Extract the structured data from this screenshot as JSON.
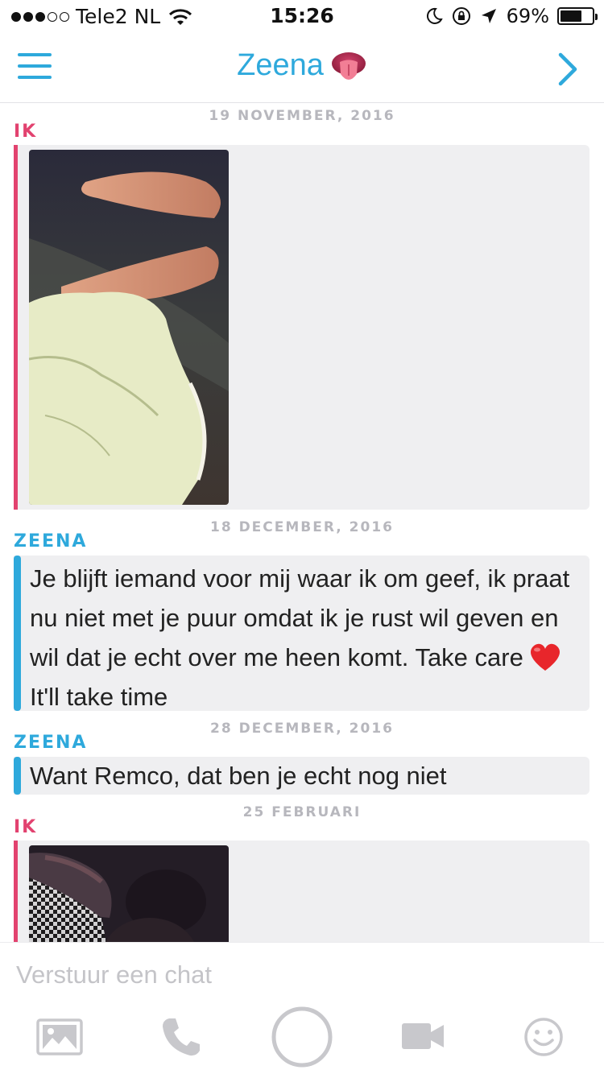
{
  "status_bar": {
    "carrier": "Tele2 NL",
    "time": "15:26",
    "battery_percent": "69%",
    "battery_level": 0.69,
    "signal_bars": 3,
    "icons": [
      "wifi-icon",
      "moon-icon",
      "rotation-lock-icon",
      "location-arrow-icon",
      "battery-icon"
    ]
  },
  "nav": {
    "title": "Zeena",
    "title_emoji": "tongue-emoji",
    "left_icon": "menu-icon",
    "right_icon": "chevron-right-icon",
    "accent_color": "#2ea9dc"
  },
  "messages": [
    {
      "date": "19 NOVEMBER, 2016",
      "sender": "IK",
      "type": "image"
    },
    {
      "date": "18 DECEMBER, 2016",
      "sender": "ZEENA",
      "type": "text",
      "text_before_emoji": "Je blijft iemand voor mij waar ik om geef, ik praat nu niet met je puur omdat ik je rust wil geven en wil dat je echt over me heen komt. Take care",
      "emoji": "red-heart-emoji",
      "text_after_emoji": "It'll take time"
    },
    {
      "date": "28 DECEMBER, 2016",
      "sender": "ZEENA",
      "type": "text",
      "text": "Want Remco, dat ben je echt nog niet"
    },
    {
      "date": "25 FEBRUARI",
      "sender": "IK",
      "type": "image"
    }
  ],
  "colors": {
    "me": "#e2426f",
    "other": "#2ea9dc",
    "bubble": "#efeff1"
  },
  "input": {
    "placeholder": "Verstuur een chat",
    "value": ""
  },
  "toolbar": [
    "image-icon",
    "phone-icon",
    "capture-circle-icon",
    "video-icon",
    "smiley-icon"
  ]
}
